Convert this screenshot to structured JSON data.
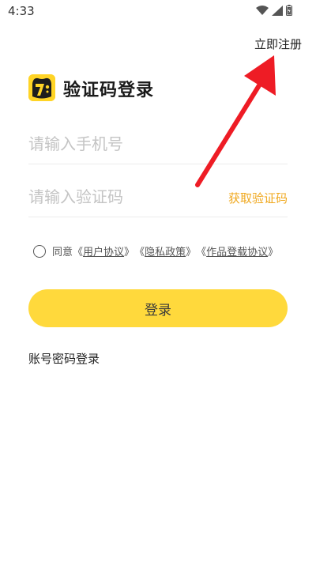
{
  "status_bar": {
    "time": "4:33",
    "icons": [
      "wifi-icon",
      "signal-icon",
      "battery-icon"
    ]
  },
  "header": {
    "register_label": "立即注册"
  },
  "title": {
    "text": "验证码登录",
    "logo_icon": "cat-face-logo-icon"
  },
  "form": {
    "phone_placeholder": "请输入手机号",
    "phone_value": "",
    "code_placeholder": "请输入验证码",
    "code_value": "",
    "get_code_label": "获取验证码"
  },
  "agreement": {
    "prefix": "同意",
    "user_agreement": "用户协议",
    "privacy_policy": "隐私政策",
    "works_agreement": "作品登载协议",
    "open_bracket": "《",
    "close_bracket": "》",
    "checked": false
  },
  "actions": {
    "login_label": "登录",
    "password_login_label": "账号密码登录"
  },
  "colors": {
    "accent": "#ffd93c",
    "link_orange": "#f0a81e",
    "annotation_arrow": "#ee1c25"
  }
}
